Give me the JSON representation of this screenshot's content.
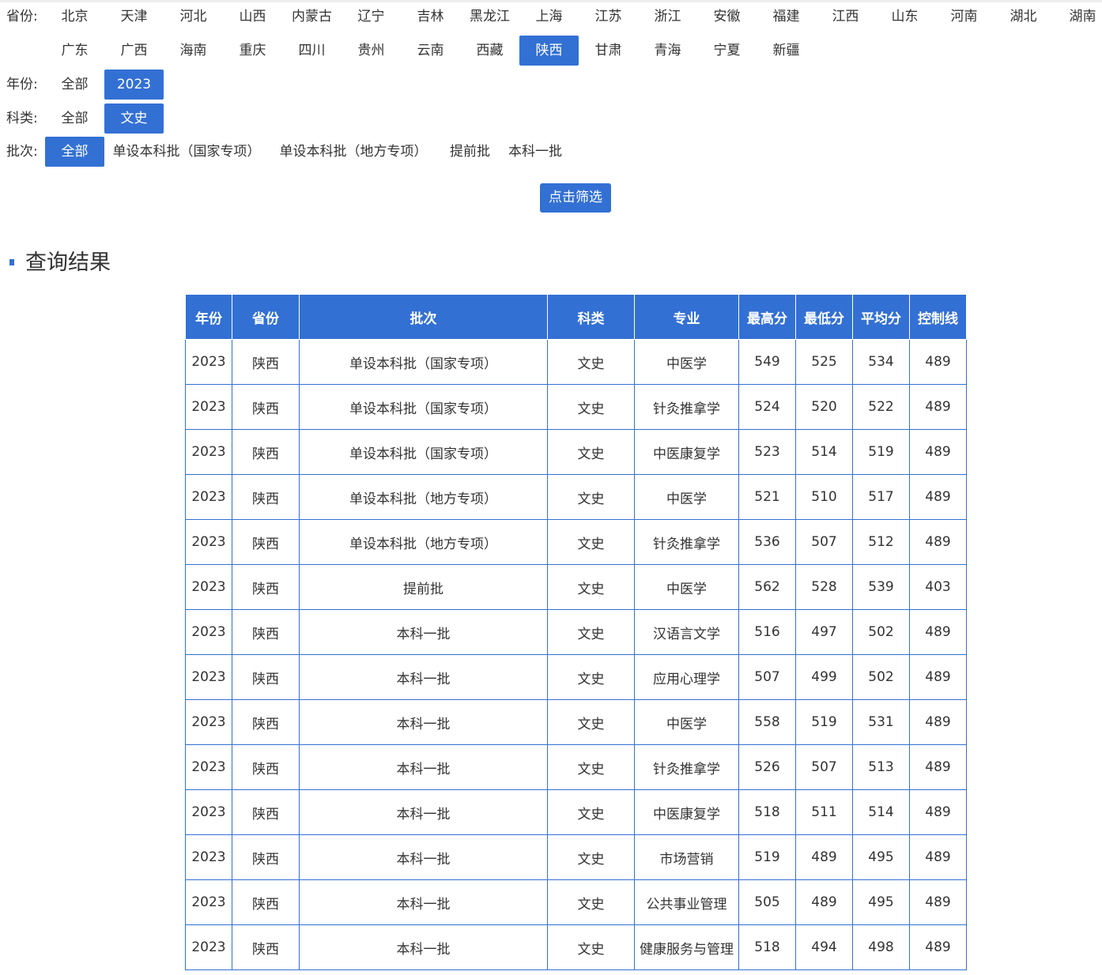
{
  "filters": {
    "province": {
      "label": "省份:",
      "row1": [
        "北京",
        "天津",
        "河北",
        "山西",
        "内蒙古",
        "辽宁",
        "吉林",
        "黑龙江",
        "上海",
        "江苏",
        "浙江",
        "安徽",
        "福建",
        "江西",
        "山东",
        "河南",
        "湖北",
        "湖南"
      ],
      "row2": [
        "广东",
        "广西",
        "海南",
        "重庆",
        "四川",
        "贵州",
        "云南",
        "西藏",
        "陕西",
        "甘肃",
        "青海",
        "宁夏",
        "新疆"
      ],
      "selected": "陕西"
    },
    "year": {
      "label": "年份:",
      "options": [
        "全部",
        "2023"
      ],
      "selected": "2023"
    },
    "subject": {
      "label": "科类:",
      "options": [
        "全部",
        "文史"
      ],
      "selected": "文史"
    },
    "batch": {
      "label": "批次:",
      "options": [
        "全部",
        "单设本科批（国家专项）",
        "单设本科批（地方专项）",
        "提前批",
        "本科一批"
      ],
      "selected": "全部"
    },
    "filter_button": "点击筛选"
  },
  "results": {
    "title": "查询结果",
    "columns": [
      "年份",
      "省份",
      "批次",
      "科类",
      "专业",
      "最高分",
      "最低分",
      "平均分",
      "控制线"
    ],
    "rows": [
      [
        "2023",
        "陕西",
        "单设本科批（国家专项）",
        "文史",
        "中医学",
        "549",
        "525",
        "534",
        "489"
      ],
      [
        "2023",
        "陕西",
        "单设本科批（国家专项）",
        "文史",
        "针灸推拿学",
        "524",
        "520",
        "522",
        "489"
      ],
      [
        "2023",
        "陕西",
        "单设本科批（国家专项）",
        "文史",
        "中医康复学",
        "523",
        "514",
        "519",
        "489"
      ],
      [
        "2023",
        "陕西",
        "单设本科批（地方专项）",
        "文史",
        "中医学",
        "521",
        "510",
        "517",
        "489"
      ],
      [
        "2023",
        "陕西",
        "单设本科批（地方专项）",
        "文史",
        "针灸推拿学",
        "536",
        "507",
        "512",
        "489"
      ],
      [
        "2023",
        "陕西",
        "提前批",
        "文史",
        "中医学",
        "562",
        "528",
        "539",
        "403"
      ],
      [
        "2023",
        "陕西",
        "本科一批",
        "文史",
        "汉语言文学",
        "516",
        "497",
        "502",
        "489"
      ],
      [
        "2023",
        "陕西",
        "本科一批",
        "文史",
        "应用心理学",
        "507",
        "499",
        "502",
        "489"
      ],
      [
        "2023",
        "陕西",
        "本科一批",
        "文史",
        "中医学",
        "558",
        "519",
        "531",
        "489"
      ],
      [
        "2023",
        "陕西",
        "本科一批",
        "文史",
        "针灸推拿学",
        "526",
        "507",
        "513",
        "489"
      ],
      [
        "2023",
        "陕西",
        "本科一批",
        "文史",
        "中医康复学",
        "518",
        "511",
        "514",
        "489"
      ],
      [
        "2023",
        "陕西",
        "本科一批",
        "文史",
        "市场营销",
        "519",
        "489",
        "495",
        "489"
      ],
      [
        "2023",
        "陕西",
        "本科一批",
        "文史",
        "公共事业管理",
        "505",
        "489",
        "495",
        "489"
      ],
      [
        "2023",
        "陕西",
        "本科一批",
        "文史",
        "健康服务与管理",
        "518",
        "494",
        "498",
        "489"
      ]
    ]
  },
  "colors": {
    "accent": "#3370d4"
  }
}
